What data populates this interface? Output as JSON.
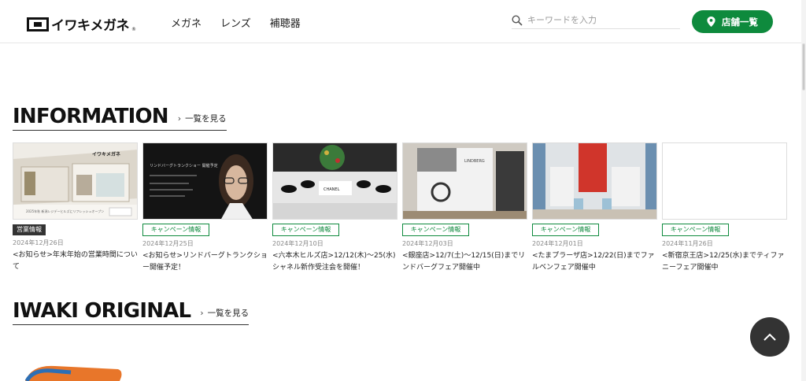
{
  "header": {
    "logo_text": "イワキメガネ",
    "logo_reg": "®",
    "nav": [
      "メガネ",
      "レンズ",
      "補聴器"
    ],
    "search_placeholder": "キーワードを入力",
    "store_button": "店舗一覧"
  },
  "information": {
    "title": "INFORMATION",
    "see_all": "一覧を見る",
    "cards": [
      {
        "tag": "営業情報",
        "tag_style": "dark",
        "date": "2024年12月26日",
        "title": "<お知らせ>年末年始の営業時間について"
      },
      {
        "tag": "キャンペーン情報",
        "tag_style": "green",
        "date": "2024年12月25日",
        "title": "<お知らせ>リンドバーグトランクショー開催予定！"
      },
      {
        "tag": "キャンペーン情報",
        "tag_style": "green",
        "date": "2024年12月10日",
        "title": "<六本木ヒルズ店>12/12(木)〜25(水)シャネル新作受注会を開催！"
      },
      {
        "tag": "キャンペーン情報",
        "tag_style": "green",
        "date": "2024年12月03日",
        "title": "<銀座店>12/7(土)〜12/15(日)までリンドバーグフェア開催中"
      },
      {
        "tag": "キャンペーン情報",
        "tag_style": "green",
        "date": "2024年12月01日",
        "title": "<たまプラーザ店>12/22(日)までファルベンフェア開催中"
      },
      {
        "tag": "キャンペーン情報",
        "tag_style": "green",
        "date": "2024年11月26日",
        "title": "<新宿京王店>12/25(水)までティファニーフェア開催中"
      }
    ]
  },
  "original": {
    "title": "IWAKI ORIGINAL",
    "see_all": "一覧を見る"
  },
  "colors": {
    "accent": "#0e8a3d",
    "dark": "#333333"
  },
  "icons": {
    "search": "search-icon",
    "store": "map-pin-icon",
    "to_top": "chevron-up-icon"
  }
}
